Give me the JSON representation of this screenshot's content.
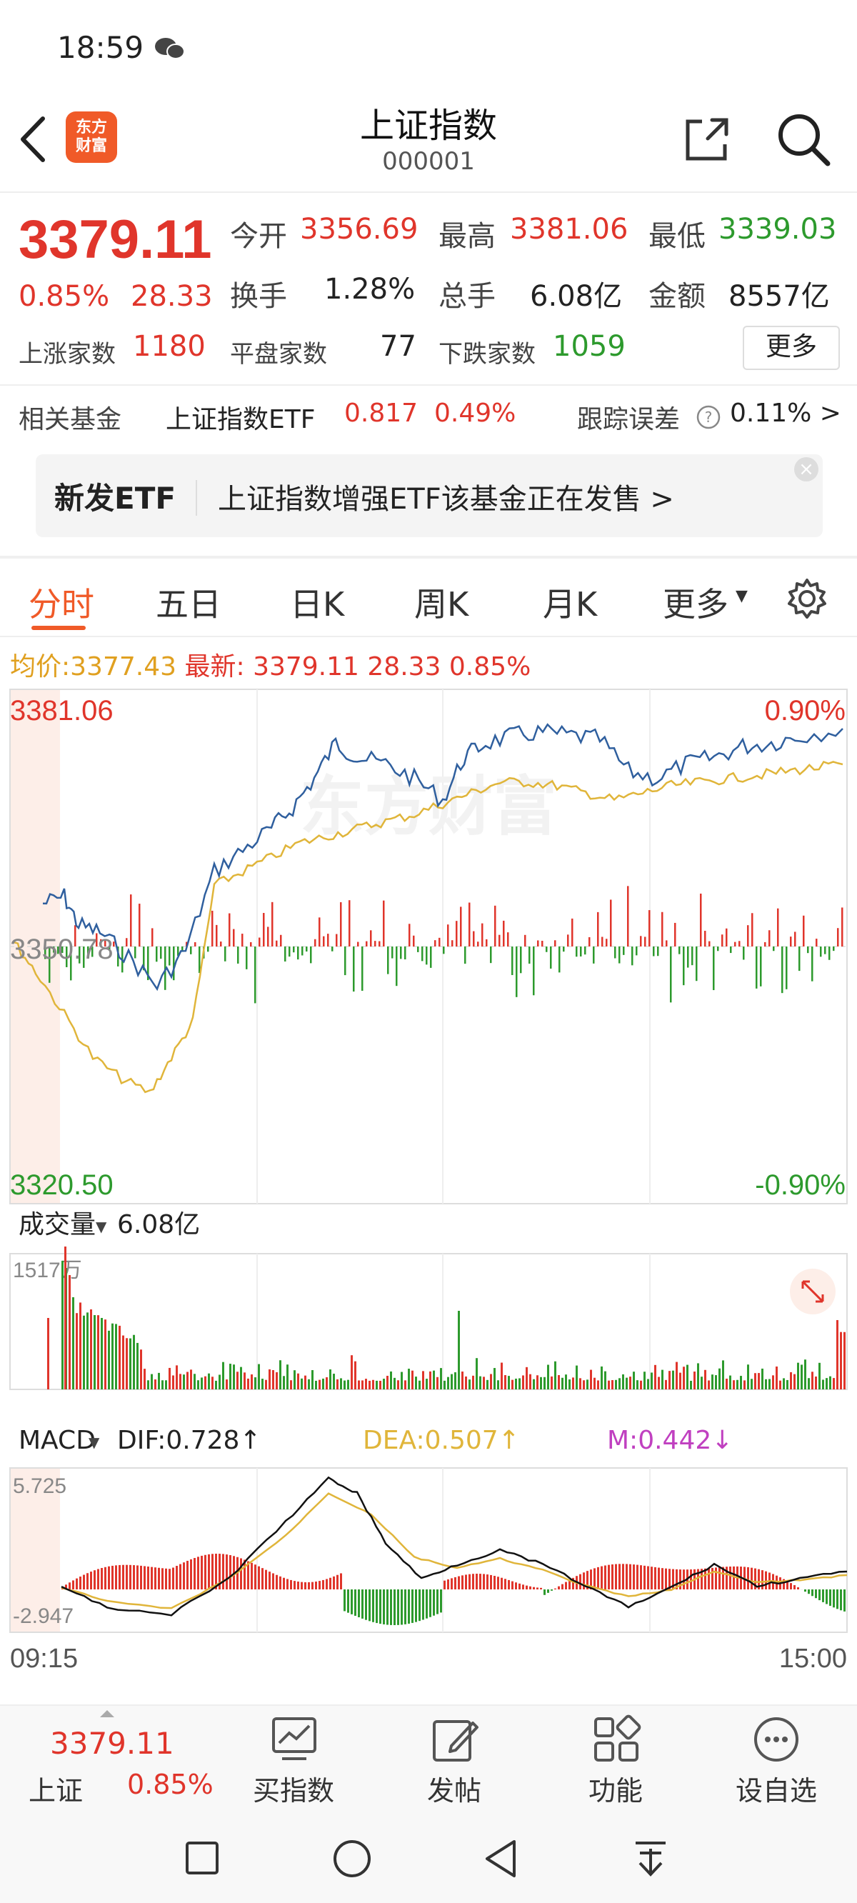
{
  "status": {
    "time": "18:59"
  },
  "header": {
    "title": "上证指数",
    "code": "000001",
    "logo_text_1": "东方",
    "logo_text_2": "财富"
  },
  "quote": {
    "price": "3379.11",
    "pct": "0.85%",
    "change": "28.33",
    "open_label": "今开",
    "open": "3356.69",
    "high_label": "最高",
    "high": "3381.06",
    "low_label": "最低",
    "low": "3339.03",
    "turnover_label": "换手",
    "turnover": "1.28%",
    "volume_label": "总手",
    "volume": "6.08亿",
    "amount_label": "金额",
    "amount": "8557亿",
    "up_label": "上涨家数",
    "up": "1180",
    "flat_label": "平盘家数",
    "flat": "77",
    "down_label": "下跌家数",
    "down": "1059",
    "more_button": "更多"
  },
  "fund": {
    "label": "相关基金",
    "name": "上证指数ETF",
    "price": "0.817",
    "pct": "0.49%",
    "tracking_label": "跟踪误差",
    "tracking_value": "0.11% >"
  },
  "banner": {
    "tag": "新发ETF",
    "text": "上证指数增强ETF该基金正在发售  >"
  },
  "tabs": [
    "分时",
    "五日",
    "日K",
    "周K",
    "月K",
    "更多"
  ],
  "intraday": {
    "avg_label": "均价:",
    "avg_value": "3377.43",
    "latest_label": "最新:",
    "latest_value": "3379.11",
    "latest_change": "28.33",
    "latest_pct": "0.85%",
    "y_top": "3381.06",
    "y_mid": "3350.78",
    "y_bottom": "3320.50",
    "pct_top": "0.90%",
    "pct_bottom": "-0.90%",
    "watermark": "东方财富"
  },
  "volume_panel": {
    "label": "成交量",
    "value": "6.08亿",
    "max": "1517万"
  },
  "macd": {
    "label": "MACD",
    "dif": "DIF:0.728↑",
    "dea": "DEA:0.507↑",
    "m": "M:0.442↓",
    "max": "5.725",
    "min": "-2.947",
    "start_time": "09:15",
    "end_time": "15:00"
  },
  "colors": {
    "red": "#e0352b",
    "green": "#2d9a2d",
    "accent": "#f05a28",
    "price_line": "#2f5f9e",
    "avg_line": "#e0b53a",
    "m_color": "#c040c0"
  },
  "bottom_nav": {
    "index_name": "上证",
    "index_price": "3379.11",
    "index_pct": "0.85%",
    "items": [
      {
        "label": "买指数",
        "icon": "chart-trend-icon"
      },
      {
        "label": "发帖",
        "icon": "edit-icon"
      },
      {
        "label": "功能",
        "icon": "grid-icon"
      },
      {
        "label": "设自选",
        "icon": "more-circle-icon"
      }
    ]
  }
}
